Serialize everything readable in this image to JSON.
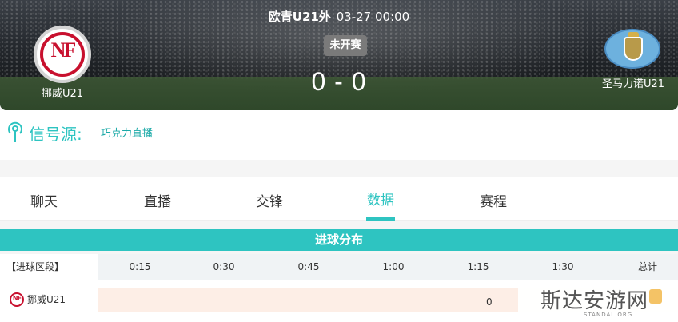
{
  "header": {
    "league": "欧青U21外",
    "datetime": "03-27 00:00",
    "status": "未开赛",
    "score": "0 - 0",
    "home": {
      "name": "挪威U21",
      "logo_text": "NF"
    },
    "away": {
      "name": "圣马力诺U21"
    }
  },
  "signal": {
    "label": "信号源:",
    "source": "巧克力直播"
  },
  "tabs": [
    {
      "label": "聊天",
      "active": false
    },
    {
      "label": "直播",
      "active": false
    },
    {
      "label": "交锋",
      "active": false
    },
    {
      "label": "数据",
      "active": true
    },
    {
      "label": "赛程",
      "active": false
    }
  ],
  "goal_distribution": {
    "title": "进球分布",
    "row_label": "【进球区段】",
    "columns": [
      "0:15",
      "0:30",
      "0:45",
      "1:00",
      "1:15",
      "1:30",
      "总计"
    ],
    "rows": [
      {
        "team": "挪威U21",
        "logo_text": "NF",
        "value": "0"
      }
    ]
  },
  "watermark": {
    "text": "斯达安游网",
    "sub": "STANDAL.ORG"
  },
  "colors": {
    "accent": "#2ec4c1",
    "home_red": "#c8102e",
    "row_tint": "#fdeee6"
  }
}
